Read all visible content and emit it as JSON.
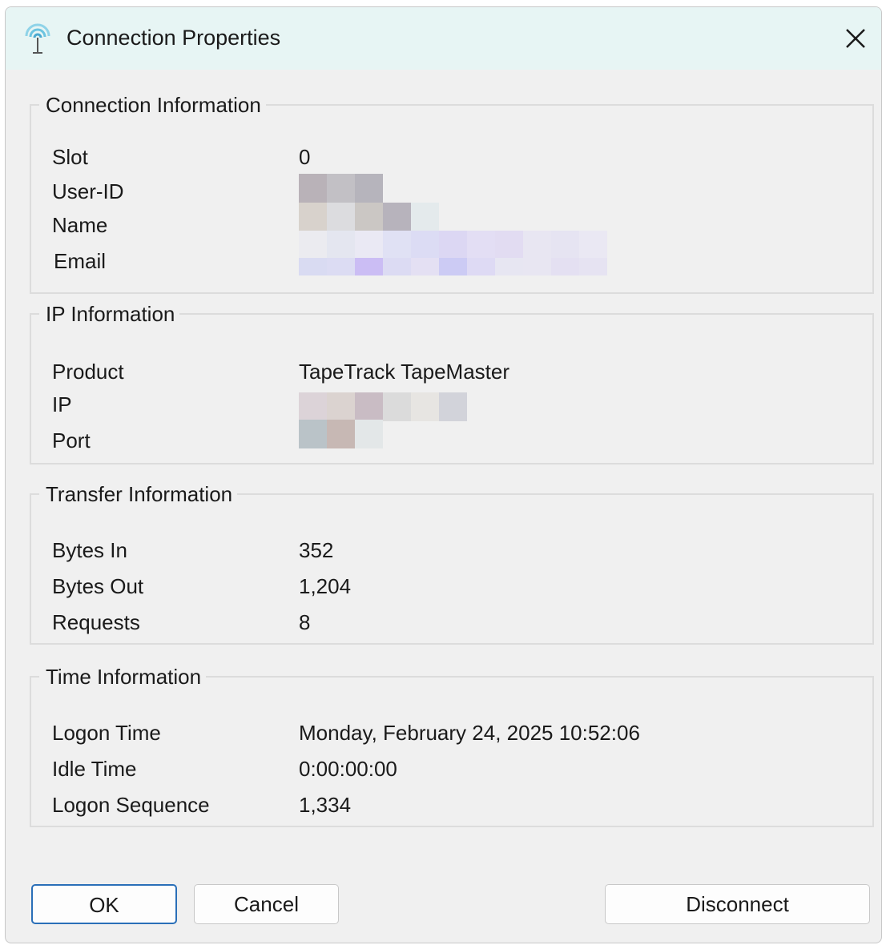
{
  "window": {
    "title": "Connection Properties",
    "icon": "antenna-icon",
    "close_icon": "close-icon"
  },
  "connection_info": {
    "legend": "Connection Information",
    "slot_label": "Slot",
    "slot_value": "0",
    "userid_label": "User-ID",
    "name_label": "Name",
    "email_label": "Email"
  },
  "ip_info": {
    "legend": "IP Information",
    "product_label": "Product",
    "product_value": "TapeTrack TapeMaster",
    "ip_label": "IP",
    "port_label": "Port"
  },
  "transfer_info": {
    "legend": "Transfer Information",
    "bytes_in_label": "Bytes In",
    "bytes_in_value": "352",
    "bytes_out_label": "Bytes Out",
    "bytes_out_value": "1,204",
    "requests_label": "Requests",
    "requests_value": "8"
  },
  "time_info": {
    "legend": "Time Information",
    "logon_time_label": "Logon Time",
    "logon_time_value": "Monday, February 24, 2025 10:52:06",
    "idle_time_label": "Idle Time",
    "idle_time_value": "0:00:00:00",
    "logon_sequence_label": "Logon Sequence",
    "logon_sequence_value": "1,334"
  },
  "buttons": {
    "ok": "OK",
    "cancel": "Cancel",
    "disconnect": "Disconnect"
  },
  "colors": {
    "titlebar": "#e7f5f4",
    "dialog_bg": "#f0f0f0",
    "default_button_border": "#2a6fb8"
  }
}
